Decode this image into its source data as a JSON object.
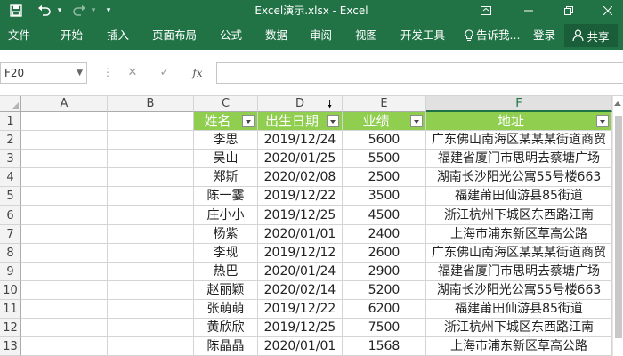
{
  "window": {
    "title": "Excel演示.xlsx - Excel",
    "quick_access": {
      "save_icon": "save-icon",
      "undo_icon": "undo-icon",
      "undo_dropdown": "▾",
      "redo_icon": "redo-icon",
      "redo_dropdown": "▾",
      "customize": "▾"
    },
    "controls": [
      "ribbon-display-icon",
      "minimize-icon",
      "restore-icon",
      "close-icon"
    ]
  },
  "ribbon": {
    "tabs": [
      "文件",
      "开始",
      "插入",
      "页面布局",
      "公式",
      "数据",
      "审阅",
      "视图",
      "开发工具"
    ],
    "tell_me": "告诉我...",
    "signin": "登录",
    "share": "共享"
  },
  "formula_bar": {
    "name_box": "F20",
    "cancel_icon": "✕",
    "enter_icon": "✓",
    "fx_label": "fx",
    "value": ""
  },
  "grid": {
    "columns": [
      "A",
      "B",
      "C",
      "D",
      "E",
      "F"
    ],
    "selected_column": "F",
    "headers": {
      "name": "姓名",
      "birthdate": "出生日期",
      "performance": "业绩",
      "address": "地址"
    },
    "rows": [
      {
        "num": "1"
      },
      {
        "num": "2",
        "name": "李思",
        "date": "2019/12/24",
        "perf": "5600",
        "addr": "广东佛山南海区某某某街道商贸"
      },
      {
        "num": "3",
        "name": "吴山",
        "date": "2020/01/25",
        "perf": "5500",
        "addr": "福建省厦门市思明去蔡塘广场"
      },
      {
        "num": "4",
        "name": "郑斯",
        "date": "2020/02/08",
        "perf": "2500",
        "addr": "湖南长沙阳光公寓55号楼663"
      },
      {
        "num": "5",
        "name": "陈一霎",
        "date": "2019/12/22",
        "perf": "3500",
        "addr": "福建莆田仙游县85街道"
      },
      {
        "num": "6",
        "name": "庄小小",
        "date": "2019/12/25",
        "perf": "4500",
        "addr": "浙江杭州下城区东西路江南"
      },
      {
        "num": "7",
        "name": "杨紫",
        "date": "2020/01/01",
        "perf": "2400",
        "addr": "上海市浦东新区草高公路"
      },
      {
        "num": "8",
        "name": "李现",
        "date": "2019/12/12",
        "perf": "2600",
        "addr": "广东佛山南海区某某某街道商贸"
      },
      {
        "num": "9",
        "name": "热巴",
        "date": "2020/01/24",
        "perf": "2900",
        "addr": "福建省厦门市思明去蔡塘广场"
      },
      {
        "num": "10",
        "name": "赵丽颖",
        "date": "2020/02/14",
        "perf": "5200",
        "addr": "湖南长沙阳光公寓55号楼663"
      },
      {
        "num": "11",
        "name": "张萌萌",
        "date": "2019/12/22",
        "perf": "6200",
        "addr": "福建莆田仙游县85街道"
      },
      {
        "num": "12",
        "name": "黄欣欣",
        "date": "2019/12/25",
        "perf": "7500",
        "addr": "浙江杭州下城区东西路江南"
      },
      {
        "num": "13",
        "name": "陈晶晶",
        "date": "2020/01/01",
        "perf": "1568",
        "addr": "上海市浦东新区草高公路"
      }
    ]
  },
  "colors": {
    "excel_green": "#217346",
    "header_fill": "#8fce4e",
    "header_text": "#ffffff"
  }
}
